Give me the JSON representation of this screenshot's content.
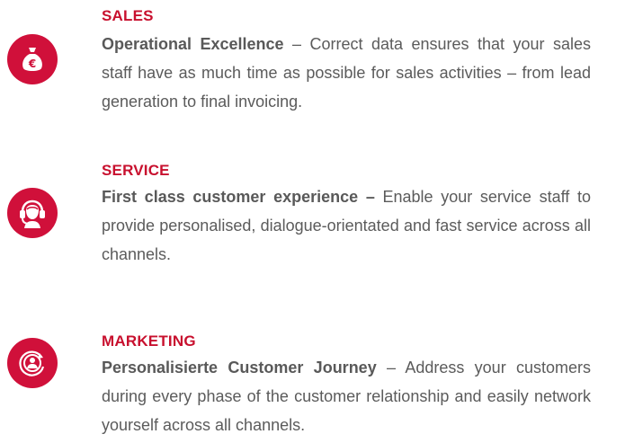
{
  "sections": [
    {
      "icon": "money-bag-euro-icon",
      "heading": "SALES",
      "lead": "Operational Excellence",
      "text": " – Correct data ensures that your sales staff have as much time as possible for sales activities – from lead generation to final invoicing."
    },
    {
      "icon": "headset-agent-icon",
      "heading": "SERVICE",
      "lead": "First class customer experience –",
      "text": " Enable your service staff to provide personalised, dialogue-orientated and fast service across all channels."
    },
    {
      "icon": "customer-journey-icon",
      "heading": "MARKETING",
      "lead": "Personalisierte Customer Journey",
      "text": " – Address your customers during every phase of the customer relation­ship and easily network yourself across all channels."
    }
  ],
  "colors": {
    "accent": "#d0103a",
    "heading": "#c8102e",
    "text": "#5b5b5b"
  }
}
